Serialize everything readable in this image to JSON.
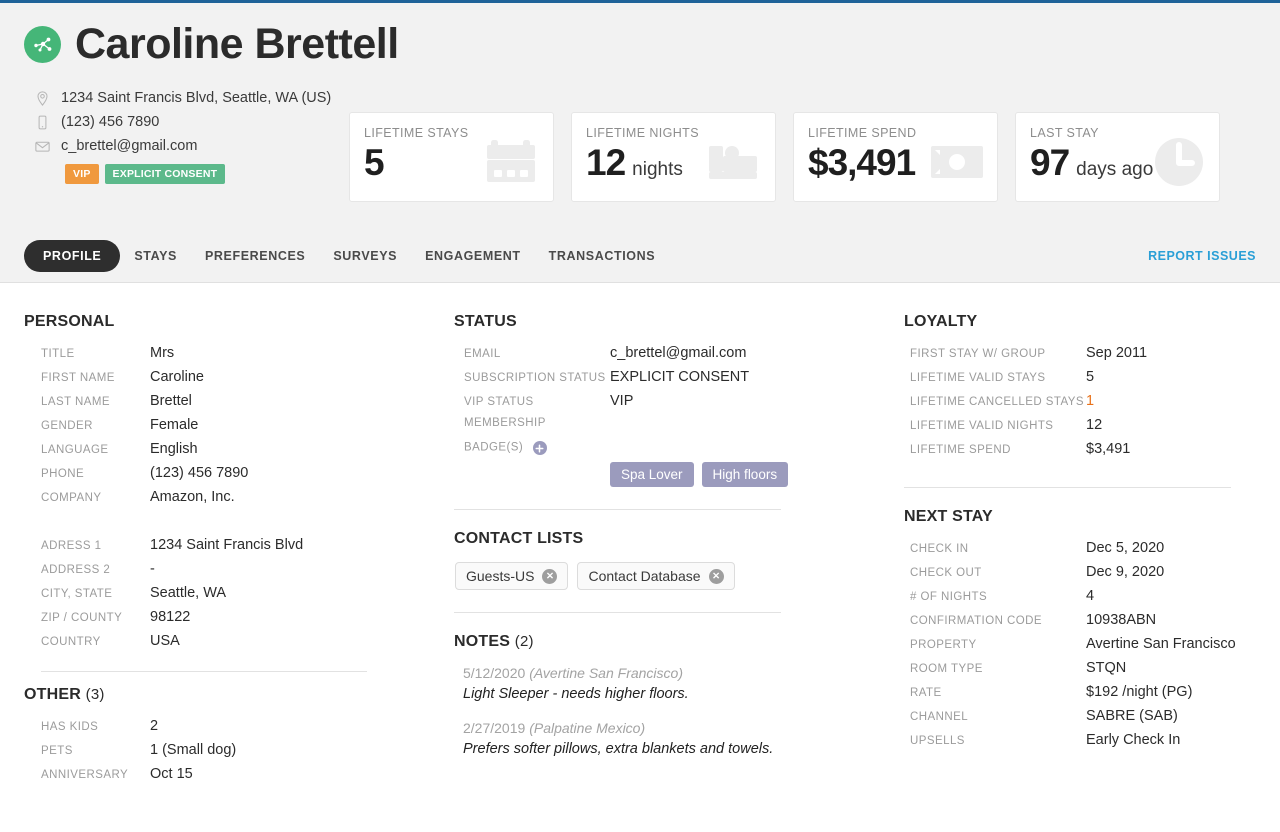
{
  "header": {
    "logo_icon": "network-nodes-icon",
    "title": "Caroline Brettell",
    "contact": {
      "address": "1234 Saint Francis Blvd, Seattle, WA (US)",
      "phone": "(123) 456 7890",
      "email": "c_brettel@gmail.com"
    },
    "badges": [
      {
        "label": "VIP",
        "color": "#f0993e"
      },
      {
        "label": "EXPLICIT CONSENT",
        "color": "#5cb98b"
      }
    ]
  },
  "stats": [
    {
      "label": "LIFETIME STAYS",
      "value": "5",
      "unit": "",
      "icon": "calendar-icon"
    },
    {
      "label": "LIFETIME NIGHTS",
      "value": "12",
      "unit": "nights",
      "icon": "bed-icon"
    },
    {
      "label": "LIFETIME SPEND",
      "value": "$3,491",
      "unit": "",
      "icon": "money-icon"
    },
    {
      "label": "LAST STAY",
      "value": "97",
      "unit": "days ago",
      "icon": "clock-icon"
    }
  ],
  "tabs": [
    {
      "label": "PROFILE",
      "active": true
    },
    {
      "label": "STAYS",
      "active": false
    },
    {
      "label": "PREFERENCES",
      "active": false
    },
    {
      "label": "SURVEYS",
      "active": false
    },
    {
      "label": "ENGAGEMENT",
      "active": false
    },
    {
      "label": "TRANSACTIONS",
      "active": false
    }
  ],
  "report_issues": "REPORT ISSUES",
  "personal": {
    "heading": "PERSONAL",
    "rows": [
      {
        "k": "TITLE",
        "v": "Mrs"
      },
      {
        "k": "FIRST NAME",
        "v": "Caroline"
      },
      {
        "k": "LAST NAME",
        "v": "Brettel"
      },
      {
        "k": "GENDER",
        "v": "Female"
      },
      {
        "k": "LANGUAGE",
        "v": "English"
      },
      {
        "k": "PHONE",
        "v": "(123) 456 7890"
      },
      {
        "k": "COMPANY",
        "v": "Amazon, Inc."
      }
    ],
    "address_rows": [
      {
        "k": "ADRESS 1",
        "v": "1234 Saint Francis Blvd"
      },
      {
        "k": "ADDRESS 2",
        "v": "-"
      },
      {
        "k": "CITY, STATE",
        "v": "Seattle, WA"
      },
      {
        "k": "ZIP / COUNTY",
        "v": "98122"
      },
      {
        "k": "COUNTRY",
        "v": "USA"
      }
    ]
  },
  "other": {
    "heading": "OTHER",
    "count": "(3)",
    "rows": [
      {
        "k": "HAS KIDS",
        "v": "2"
      },
      {
        "k": "PETS",
        "v": "1 (Small dog)"
      },
      {
        "k": "ANNIVERSARY",
        "v": "Oct 15"
      }
    ]
  },
  "status": {
    "heading": "STATUS",
    "rows": [
      {
        "k": "EMAIL",
        "v": "c_brettel@gmail.com"
      },
      {
        "k": "SUBSCRIPTION STATUS",
        "v": "EXPLICIT CONSENT"
      },
      {
        "k": "VIP STATUS",
        "v": "VIP"
      },
      {
        "k": "MEMBERSHIP",
        "v": ""
      }
    ],
    "badges_label": "BADGE(S)",
    "add_badge_icon": "plus-circle-icon",
    "badge_chips": [
      "Spa Lover",
      "High floors"
    ],
    "badge_chip_color": "#9b9bbd"
  },
  "contact_lists": {
    "heading": "CONTACT LISTS",
    "chips": [
      "Guests-US",
      "Contact Database"
    ]
  },
  "notes": {
    "heading": "NOTES",
    "count": "(2)",
    "items": [
      {
        "date": "5/12/2020",
        "property": "(Avertine San Francisco)",
        "text": "Light Sleeper - needs higher floors."
      },
      {
        "date": "2/27/2019",
        "property": "(Palpatine Mexico)",
        "text": "Prefers softer pillows, extra blankets and towels."
      }
    ]
  },
  "loyalty": {
    "heading": "LOYALTY",
    "rows": [
      {
        "k": "FIRST STAY W/ GROUP",
        "v": "Sep 2011",
        "highlight": false
      },
      {
        "k": "LIFETIME VALID STAYS",
        "v": "5",
        "highlight": false
      },
      {
        "k": "LIFETIME CANCELLED STAYS",
        "v": "1",
        "highlight": true
      },
      {
        "k": "LIFETIME VALID NIGHTS",
        "v": "12",
        "highlight": false
      },
      {
        "k": "LIFETIME SPEND",
        "v": "$3,491",
        "highlight": false
      }
    ],
    "highlight_color": "#e8711a"
  },
  "next_stay": {
    "heading": "NEXT STAY",
    "rows": [
      {
        "k": "CHECK IN",
        "v": "Dec 5, 2020"
      },
      {
        "k": "CHECK OUT",
        "v": "Dec 9, 2020"
      },
      {
        "k": "# OF NIGHTS",
        "v": "4"
      },
      {
        "k": "CONFIRMATION CODE",
        "v": "10938ABN"
      },
      {
        "k": "PROPERTY",
        "v": "Avertine San Francisco"
      },
      {
        "k": "ROOM TYPE",
        "v": "STQN"
      },
      {
        "k": "RATE",
        "v": "$192 /night (PG)"
      },
      {
        "k": "CHANNEL",
        "v": "SABRE (SAB)"
      },
      {
        "k": "UPSELLS",
        "v": "Early Check In"
      }
    ]
  }
}
